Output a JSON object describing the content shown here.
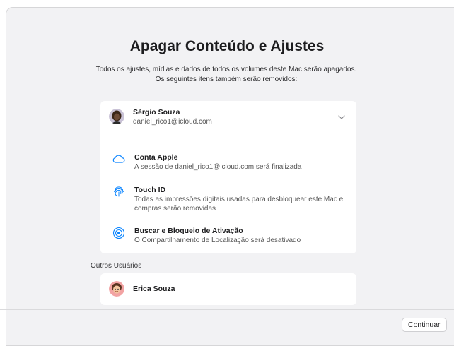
{
  "page": {
    "title": "Apagar Conteúdo e Ajustes",
    "subtitle": "Todos os ajustes, mídias e dados de todos os volumes deste Mac serão apagados. Os seguintes itens também serão removidos:"
  },
  "account": {
    "name": "Sérgio Souza",
    "email": "daniel_rico1@icloud.com",
    "icon": "chevron-down-icon"
  },
  "items": [
    {
      "title": "Conta Apple",
      "description": "A sessão de daniel_rico1@icloud.com será finalizada",
      "icon": "cloud-icon"
    },
    {
      "title": "Touch ID",
      "description": "Todas as impressões digitais usadas para desbloquear este Mac e compras serão removidas",
      "icon": "fingerprint-icon"
    },
    {
      "title": "Buscar e Bloqueio de Ativação",
      "description": "O Compartilhamento de Localização será desativado",
      "icon": "find-my-icon"
    }
  ],
  "other_users": {
    "label": "Outros Usuários",
    "users": [
      {
        "name": "Erica Souza"
      }
    ]
  },
  "footer": {
    "continue_label": "Continuar"
  },
  "colors": {
    "accent": "#0a84ff",
    "window_bg": "#f2f2f4"
  }
}
